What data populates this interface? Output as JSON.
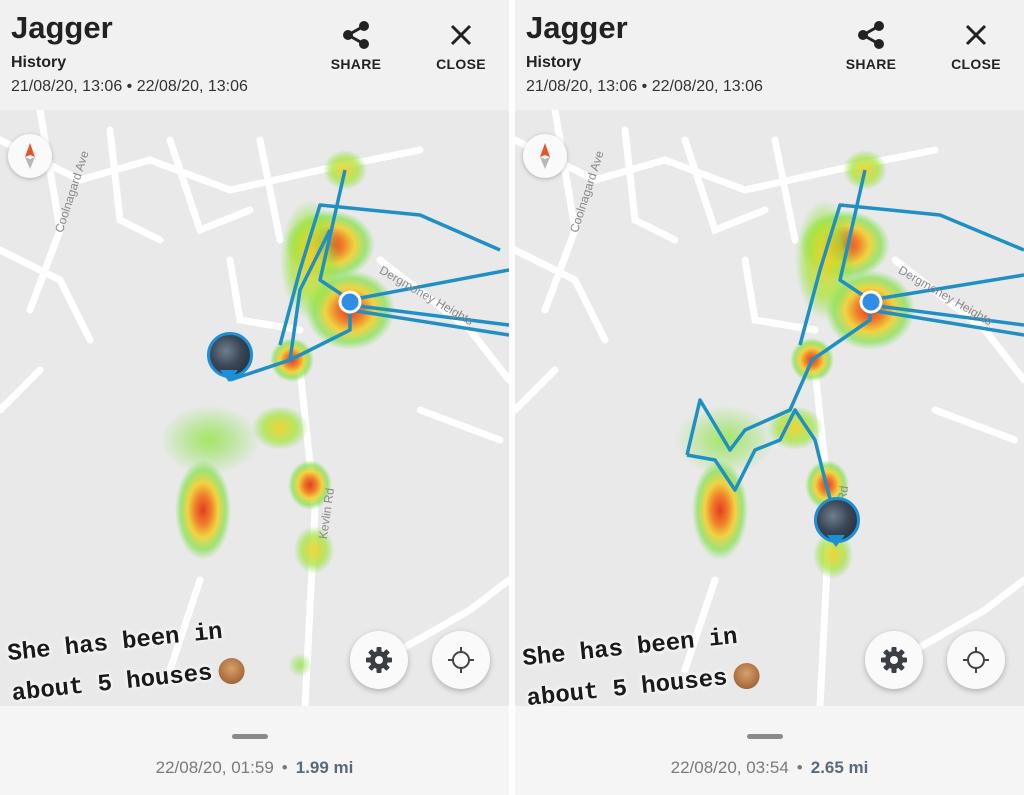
{
  "panels": [
    {
      "header": {
        "title": "Jagger",
        "subtitle": "History",
        "range": "21/08/20, 13:06 • 22/08/20, 13:06",
        "share_label": "SHARE",
        "close_label": "CLOSE"
      },
      "map": {
        "roads": {
          "coolnagard": "Coolnagard Ave",
          "dergmoney": "Dergmoney Heights",
          "kevlin": "Kevlin Rd"
        }
      },
      "caption": {
        "line1": "She has been in",
        "line2": "about 5 houses"
      },
      "footer": {
        "time": "22/08/20, 01:59",
        "separator": "•",
        "distance": "1.99 mi"
      }
    },
    {
      "header": {
        "title": "Jagger",
        "subtitle": "History",
        "range": "21/08/20, 13:06 • 22/08/20, 13:06",
        "share_label": "SHARE",
        "close_label": "CLOSE"
      },
      "map": {
        "roads": {
          "coolnagard": "Coolnagard Ave",
          "dergmoney": "Dergmoney Heights",
          "kevlin": "Rd"
        }
      },
      "caption": {
        "line1": "She has been in",
        "line2": "about 5 houses"
      },
      "footer": {
        "time": "22/08/20, 03:54",
        "separator": "•",
        "distance": "2.65 mi"
      }
    }
  ],
  "icons": {
    "share": "share-icon",
    "close": "close-icon",
    "compass": "compass-icon",
    "settings": "gear-icon",
    "locate": "crosshair-icon",
    "emoji": "see-no-evil-monkey-emoji"
  },
  "colors": {
    "track": "#1f8fc4",
    "location_dot": "#2f8de4",
    "heat_hot": "#e53b1f",
    "heat_warm": "#f2d024",
    "heat_cool": "#7fe04a"
  }
}
